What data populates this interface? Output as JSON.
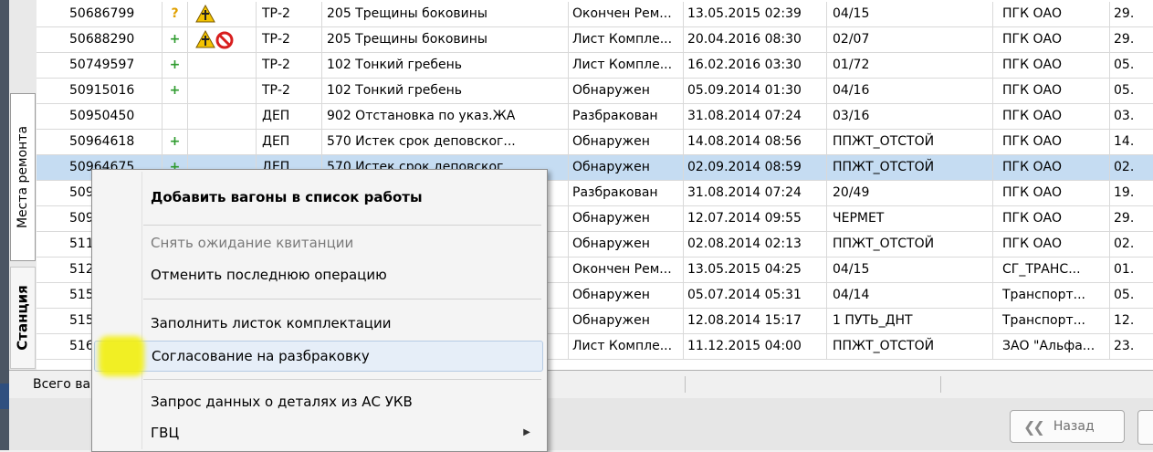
{
  "tabs": {
    "repair_places": "Места ремонта",
    "station": "Станция"
  },
  "rows": [
    {
      "id": "50686799",
      "mark": "?",
      "type": "ТР-2",
      "defect": "205 Трещины боковины",
      "status": "Окончен Рем...",
      "date": "13.05.2015 02:39",
      "place": "04/15",
      "owner": "ПГК ОАО",
      "last": "29."
    },
    {
      "id": "50688290",
      "mark": "+",
      "type": "ТР-2",
      "defect": "205 Трещины боковины",
      "status": "Лист Компле...",
      "date": "20.04.2016 08:30",
      "place": "02/07",
      "owner": "ПГК ОАО",
      "last": "29."
    },
    {
      "id": "50749597",
      "mark": "+",
      "type": "ТР-2",
      "defect": "102 Тонкий гребень",
      "status": "Лист Компле...",
      "date": "16.02.2016 03:30",
      "place": "01/72",
      "owner": "ПГК ОАО",
      "last": "05."
    },
    {
      "id": "50915016",
      "mark": "+",
      "type": "ТР-2",
      "defect": "102 Тонкий гребень",
      "status": "Обнаружен",
      "date": "05.09.2014 01:30",
      "place": "04/16",
      "owner": "ПГК ОАО",
      "last": "05."
    },
    {
      "id": "50950450",
      "mark": "",
      "type": "ДЕП",
      "defect": "902 Отстановка по указ.ЖА",
      "status": "Разбракован",
      "date": "31.08.2014 07:24",
      "place": "03/16",
      "owner": "ПГК ОАО",
      "last": "03."
    },
    {
      "id": "50964618",
      "mark": "+",
      "type": "ДЕП",
      "defect": "570 Истек срок деповског...",
      "status": "Обнаружен",
      "date": "14.08.2014 08:56",
      "place": "ППЖТ_ОТСТОЙ",
      "owner": "ПГК ОАО",
      "last": "14."
    },
    {
      "id": "50964675",
      "mark": "+",
      "type": "ДЕП",
      "defect": "570 Истек срок деповског...",
      "status": "Обнаружен",
      "date": "02.09.2014 08:59",
      "place": "ППЖТ_ОТСТОЙ",
      "owner": "ПГК ОАО",
      "last": "02."
    },
    {
      "id": "509",
      "mark": "",
      "type": "",
      "defect": "",
      "status": "Разбракован",
      "date": "31.08.2014 07:24",
      "place": "20/49",
      "owner": "ПГК ОАО",
      "last": "19."
    },
    {
      "id": "509",
      "mark": "",
      "type": "",
      "defect": "",
      "status": "Обнаружен",
      "date": "12.07.2014 09:55",
      "place": "ЧЕРМЕТ",
      "owner": "ПГК ОАО",
      "last": "29."
    },
    {
      "id": "511",
      "mark": "",
      "type": "",
      "defect": "",
      "status": "Обнаружен",
      "date": "02.08.2014 02:13",
      "place": "ППЖТ_ОТСТОЙ",
      "owner": "ПГК ОАО",
      "last": "02."
    },
    {
      "id": "512",
      "mark": "",
      "type": "",
      "defect": "",
      "status": "Окончен Рем...",
      "date": "13.05.2015 04:25",
      "place": "04/15",
      "owner": "СГ_ТРАНС...",
      "last": "01."
    },
    {
      "id": "515",
      "mark": "",
      "type": "",
      "defect": "",
      "status": "Обнаружен",
      "date": "05.07.2014 05:31",
      "place": "04/14",
      "owner": "Транспорт...",
      "last": "05."
    },
    {
      "id": "515",
      "mark": "",
      "type": "",
      "defect": "",
      "status": "Обнаружен",
      "date": "12.08.2014 15:17",
      "place": "1 ПУТЬ_ДНТ",
      "owner": "Транспорт...",
      "last": "12."
    },
    {
      "id": "516",
      "mark": "",
      "type": "",
      "defect": "",
      "status": "Лист Компле...",
      "date": "11.12.2015 04:00",
      "place": "ППЖТ_ОТСТОЙ",
      "owner": "ЗАО \"Альфа...",
      "last": "23."
    }
  ],
  "statusbar": {
    "total": "Всего ва"
  },
  "buttons": {
    "back": "Назад"
  },
  "context_menu": {
    "items": [
      {
        "label": "Добавить вагоны в список работы"
      },
      {
        "label": "Снять ожидание квитанции"
      },
      {
        "label": "Отменить последнюю операцию"
      },
      {
        "label": "Заполнить листок комплектации"
      },
      {
        "label": "Согласование на разбраковку"
      },
      {
        "label": "Запрос данных о деталях из АС УКВ"
      },
      {
        "label": "ГВЦ"
      }
    ]
  },
  "colors": {
    "selection": "#c5dcf2",
    "plus": "#2e9b2e",
    "question": "#e0a000",
    "highlight": "#f4f000"
  }
}
